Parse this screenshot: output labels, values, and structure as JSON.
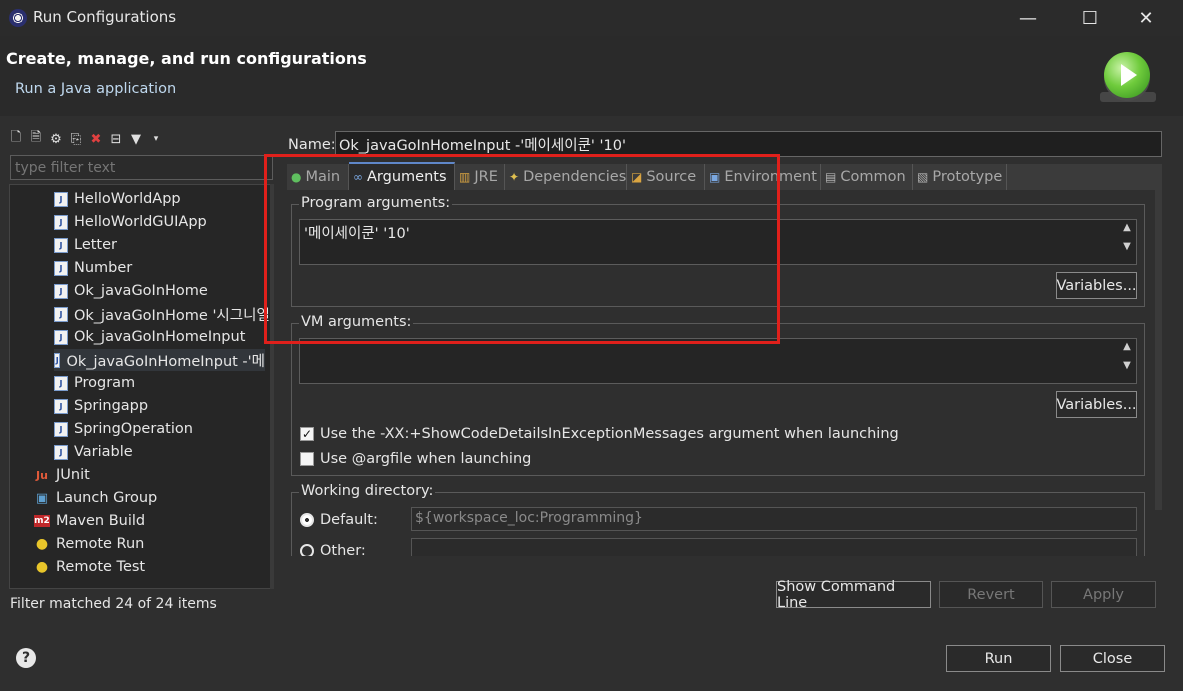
{
  "window": {
    "title": "Run Configurations",
    "controls": [
      "—",
      "☐",
      "✕"
    ]
  },
  "header": {
    "title": "Create, manage, and run configurations",
    "subtitle": "Run a Java application"
  },
  "left": {
    "filter_placeholder": "type filter text",
    "tree": [
      {
        "label": "HelloWorldApp",
        "icon": "java-app-icon",
        "indent": 1
      },
      {
        "label": "HelloWorldGUIApp",
        "icon": "java-app-icon",
        "indent": 1
      },
      {
        "label": "Letter",
        "icon": "java-app-icon",
        "indent": 1
      },
      {
        "label": "Number",
        "icon": "java-app-icon",
        "indent": 1
      },
      {
        "label": "Ok_javaGoInHome",
        "icon": "java-app-icon",
        "indent": 1
      },
      {
        "label": "Ok_javaGoInHome '시그니얼",
        "icon": "java-app-icon",
        "indent": 1
      },
      {
        "label": "Ok_javaGoInHomeInput",
        "icon": "java-app-icon",
        "indent": 1
      },
      {
        "label": "Ok_javaGoInHomeInput -'메",
        "icon": "java-app-icon",
        "indent": 1,
        "selected": true
      },
      {
        "label": "Program",
        "icon": "java-app-icon",
        "indent": 1
      },
      {
        "label": "Springapp",
        "icon": "java-app-icon",
        "indent": 1
      },
      {
        "label": "SpringOperation",
        "icon": "java-app-icon",
        "indent": 1
      },
      {
        "label": "Variable",
        "icon": "java-app-icon",
        "indent": 1
      },
      {
        "label": "JUnit",
        "icon": "junit-icon",
        "indent": 0
      },
      {
        "label": "Launch Group",
        "icon": "launch-group-icon",
        "indent": 0
      },
      {
        "label": "Maven Build",
        "icon": "maven-icon",
        "indent": 0
      },
      {
        "label": "Remote Run",
        "icon": "remote-icon",
        "indent": 0
      },
      {
        "label": "Remote Test",
        "icon": "remote-icon",
        "indent": 0
      }
    ],
    "status": "Filter matched 24 of 24 items"
  },
  "config": {
    "name_label": "Name:",
    "name_value": "Ok_javaGoInHomeInput -'메이세이쿤' '10'",
    "tabs": [
      {
        "label": "Main",
        "icon": "main-tab-icon"
      },
      {
        "label": "Arguments",
        "icon": "arguments-tab-icon",
        "active": true
      },
      {
        "label": "JRE",
        "icon": "jre-tab-icon"
      },
      {
        "label": "Dependencies",
        "icon": "dependencies-tab-icon"
      },
      {
        "label": "Source",
        "icon": "source-tab-icon"
      },
      {
        "label": "Environment",
        "icon": "environment-tab-icon"
      },
      {
        "label": "Common",
        "icon": "common-tab-icon"
      },
      {
        "label": "Prototype",
        "icon": "prototype-tab-icon"
      }
    ],
    "program_args": {
      "label": "Program arguments:",
      "value": "'메이세이쿤' '10'",
      "variables_btn": "Variables..."
    },
    "vm_args": {
      "label": "VM arguments:",
      "value": "",
      "variables_btn": "Variables...",
      "check1": "Use the -XX:+ShowCodeDetailsInExceptionMessages argument when launching",
      "check1_checked": true,
      "check2": "Use @argfile when launching",
      "check2_checked": false
    },
    "workdir": {
      "label": "Working directory:",
      "default_label": "Default:",
      "default_value": "${workspace_loc:Programming}",
      "other_label": "Other:",
      "other_value": ""
    },
    "buttons": {
      "show_cmd": "Show Command Line",
      "revert": "Revert",
      "apply": "Apply"
    }
  },
  "footer": {
    "run": "Run",
    "close": "Close"
  },
  "colors": {
    "highlight_box": "#e0201b",
    "accent": "#5f87c9"
  }
}
